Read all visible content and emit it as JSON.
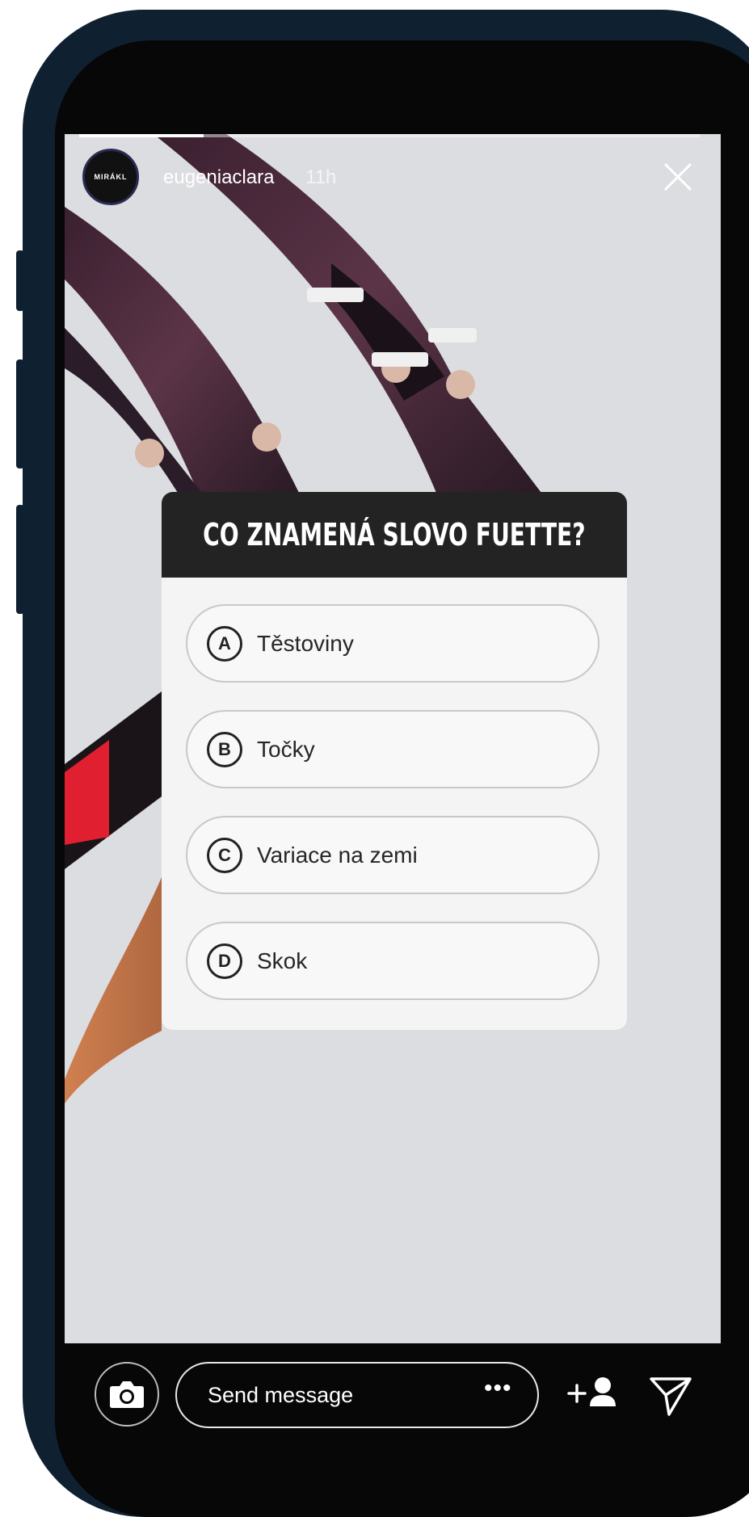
{
  "story": {
    "avatar_text": "MIRÁKL",
    "username": "eugeniaclara",
    "time": "11h",
    "progress_fraction": 0.2
  },
  "quiz": {
    "question": "CO ZNAMENÁ SLOVO FUETTE?",
    "options": [
      {
        "letter": "A",
        "text": "Těstoviny"
      },
      {
        "letter": "B",
        "text": "Točky"
      },
      {
        "letter": "C",
        "text": "Variace na zemi"
      },
      {
        "letter": "D",
        "text": "Skok"
      }
    ]
  },
  "bottom_bar": {
    "message_placeholder": "Send message",
    "more_label": "•••"
  },
  "icons": {
    "close": "close-icon",
    "camera": "camera-icon",
    "add_friend": "add-person-icon",
    "send": "send-icon"
  },
  "colors": {
    "card_header": "#232323",
    "screen_background": "#dcdde0"
  }
}
